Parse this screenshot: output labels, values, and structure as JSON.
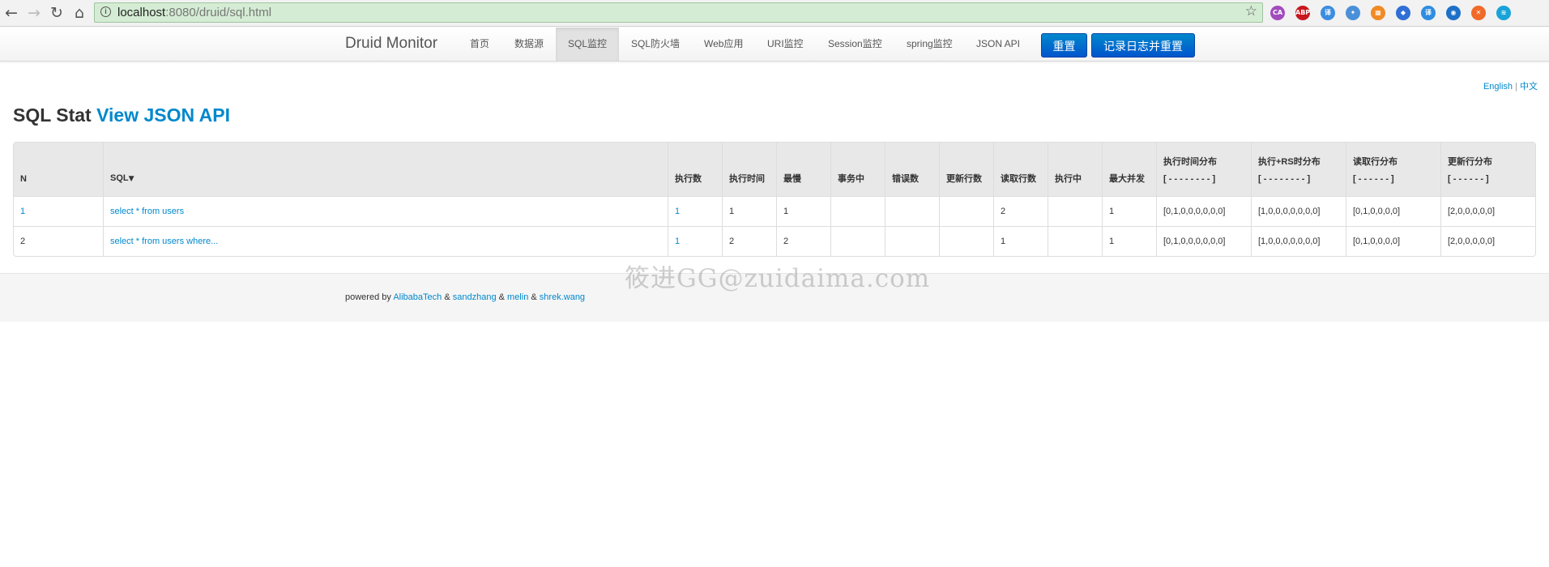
{
  "browser": {
    "back_icon": "←",
    "forward_icon": "→",
    "reload_icon": "↻",
    "home_icon": "⌂",
    "url_host": "localhost",
    "url_path": ":8080/druid/sql.html",
    "info_icon": "i",
    "star_icon": "☆",
    "extensions": [
      {
        "name": "translate-ext-icon",
        "glyph": "CA",
        "color": "#a24bbf"
      },
      {
        "name": "adblock-plus-icon",
        "glyph": "ABP",
        "color": "#c6181e"
      },
      {
        "name": "translator-ext-icon",
        "glyph": "译",
        "color": "#3b8de0"
      },
      {
        "name": "puzzle-ext-icon",
        "glyph": "✦",
        "color": "#4a90d9"
      },
      {
        "name": "calculator-ext-icon",
        "glyph": "▦",
        "color": "#f08a24"
      },
      {
        "name": "shield-ext-icon",
        "glyph": "◆",
        "color": "#2f6fd6"
      },
      {
        "name": "dictionary-ext-icon",
        "glyph": "译",
        "color": "#2e8de0"
      },
      {
        "name": "chat-ext-icon",
        "glyph": "◉",
        "color": "#1e70c8"
      },
      {
        "name": "close-ext-icon",
        "glyph": "✕",
        "color": "#f06a2a"
      },
      {
        "name": "wifi-ext-icon",
        "glyph": "≋",
        "color": "#1aa3d8"
      }
    ]
  },
  "nav": {
    "brand": "Druid Monitor",
    "items": [
      {
        "label": "首页",
        "active": false
      },
      {
        "label": "数据源",
        "active": false
      },
      {
        "label": "SQL监控",
        "active": true
      },
      {
        "label": "SQL防火墙",
        "active": false
      },
      {
        "label": "Web应用",
        "active": false
      },
      {
        "label": "URI监控",
        "active": false
      },
      {
        "label": "Session监控",
        "active": false
      },
      {
        "label": "spring监控",
        "active": false
      },
      {
        "label": "JSON API",
        "active": false
      }
    ],
    "reset_button": "重置",
    "log_reset_button": "记录日志并重置"
  },
  "lang": {
    "english": "English",
    "separator": "|",
    "chinese": "中文"
  },
  "page": {
    "title_prefix": "SQL Stat",
    "title_link": "View JSON API"
  },
  "table": {
    "headers": {
      "n": "N",
      "sql": "SQL",
      "sort_arrow": "▼",
      "exec_count": "执行数",
      "exec_time": "执行时间",
      "slowest": "最慢",
      "in_txn": "事务中",
      "errors": "错误数",
      "update_rows": "更新行数",
      "fetch_rows": "读取行数",
      "running": "执行中",
      "max_concurrent": "最大并发",
      "exec_hist": "执行时间分布",
      "exec_hist_sub": "[ - - - - - - - - ]",
      "exec_rs_hist": "执行+RS时分布",
      "exec_rs_hist_sub": "[ - - - - - - - - ]",
      "fetch_hist": "读取行分布",
      "fetch_hist_sub": "[ - - - - - - ]",
      "update_hist": "更新行分布",
      "update_hist_sub": "[ - - - - - - ]"
    },
    "rows": [
      {
        "n": "1",
        "sql": "select * from users",
        "exec_count": "1",
        "exec_time": "1",
        "slowest": "1",
        "in_txn": "",
        "errors": "",
        "update_rows": "",
        "fetch_rows": "2",
        "running": "",
        "max_concurrent": "1",
        "exec_hist": "[0,1,0,0,0,0,0,0]",
        "exec_rs_hist": "[1,0,0,0,0,0,0,0]",
        "fetch_hist": "[0,1,0,0,0,0]",
        "update_hist": "[2,0,0,0,0,0]"
      },
      {
        "n": "2",
        "sql": "select * from users where...",
        "exec_count": "1",
        "exec_time": "2",
        "slowest": "2",
        "in_txn": "",
        "errors": "",
        "update_rows": "",
        "fetch_rows": "1",
        "running": "",
        "max_concurrent": "1",
        "exec_hist": "[0,1,0,0,0,0,0,0]",
        "exec_rs_hist": "[1,0,0,0,0,0,0,0]",
        "fetch_hist": "[0,1,0,0,0,0]",
        "update_hist": "[2,0,0,0,0,0]"
      }
    ]
  },
  "footer": {
    "prefix": "powered by",
    "author1": "AlibabaTech",
    "amp": "&",
    "author2": "sandzhang",
    "author3": "melin",
    "author4": "shrek.wang"
  },
  "watermark": "筱进GG@zuidaima.com"
}
